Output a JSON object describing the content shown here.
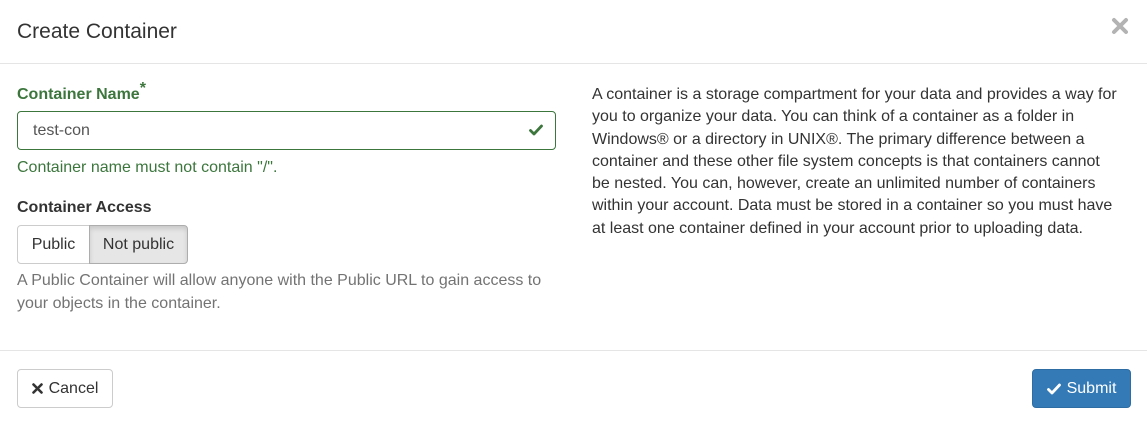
{
  "dialog": {
    "title": "Create Container",
    "close_icon": "close-icon"
  },
  "form": {
    "name_label": "Container Name",
    "required_marker": "*",
    "name_value": "test-con",
    "name_valid_icon": "check-icon",
    "name_help": "Container name must not contain \"/\".",
    "access_label": "Container Access",
    "access_options": [
      "Public",
      "Not public"
    ],
    "access_selected": "Not public",
    "access_help": "A Public Container will allow anyone with the Public URL to gain access to your objects in the container."
  },
  "description": "A container is a storage compartment for your data and provides a way for you to organize your data. You can think of a container as a folder in Windows® or a directory in UNIX®. The primary difference between a container and these other file system concepts is that containers cannot be nested. You can, however, create an unlimited number of containers within your account. Data must be stored in a container so you must have at least one container defined in your account prior to uploading data.",
  "footer": {
    "cancel_label": "Cancel",
    "cancel_icon": "times-icon",
    "submit_label": "Submit",
    "submit_icon": "check-icon"
  },
  "colors": {
    "success": "#3c763d",
    "primary": "#337ab7",
    "help_text": "#737373"
  }
}
